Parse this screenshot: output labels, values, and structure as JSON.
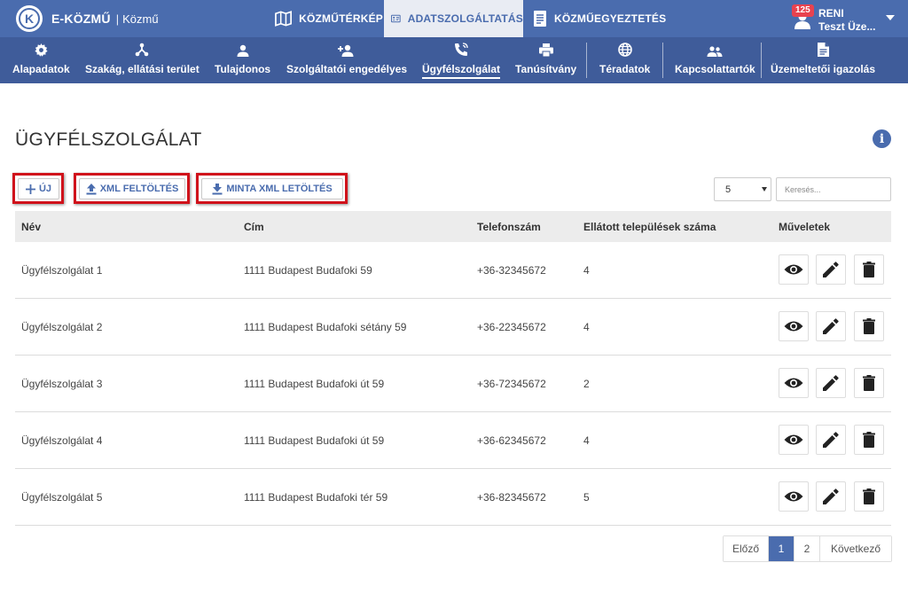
{
  "colors": {
    "primary": "#4a6cae",
    "subnav": "#3f5c9a",
    "highlight": "#d0121b",
    "badge": "#e8424f"
  },
  "brand": {
    "name": "E-KÖZMŰ",
    "separator": "|",
    "sub": "Közmű"
  },
  "top_tabs": [
    {
      "label": "KÖZMŰTÉRKÉP",
      "icon": "map-icon"
    },
    {
      "label": "ADATSZOLGÁLTATÁS",
      "icon": "id-card-icon",
      "active": true
    },
    {
      "label": "KÖZMŰEGYEZTETÉS",
      "icon": "document-icon"
    }
  ],
  "user": {
    "badge": "125",
    "name": "RENI",
    "org": "Teszt Üze..."
  },
  "subnav": [
    {
      "label": "Alapadatok",
      "icon": "gear-icon"
    },
    {
      "label": "Szakág, ellátási terület",
      "icon": "network-icon"
    },
    {
      "label": "Tulajdonos",
      "icon": "person-icon"
    },
    {
      "label": "Szolgáltatói engedélyes",
      "icon": "person-add-icon"
    },
    {
      "label": "Ügyfélszolgálat",
      "icon": "phone-icon",
      "active": true
    },
    {
      "label": "Tanúsítvány",
      "icon": "printer-icon"
    },
    {
      "label": "Téradatok",
      "icon": "globe-icon"
    },
    {
      "label": "Kapcsolattartók",
      "icon": "people-icon"
    },
    {
      "label": "Üzemeltetői igazolás",
      "icon": "file-icon"
    }
  ],
  "page": {
    "title": "ÜGYFÉLSZOLGÁLAT",
    "info": "i"
  },
  "toolbar": {
    "new_label": "ÚJ",
    "xml_upload_label": "XML FELTÖLTÉS",
    "sample_xml_label": "MINTA XML LETÖLTÉS",
    "page_size": "5",
    "search_placeholder": "Keresés..."
  },
  "table": {
    "headers": [
      "Név",
      "Cím",
      "Telefonszám",
      "Ellátott települések száma",
      "Műveletek"
    ],
    "rows": [
      [
        "Ügyfélszolgálat 1",
        "1111 Budapest Budafoki 59",
        "+36-32345672",
        "4"
      ],
      [
        "Ügyfélszolgálat 2",
        "1111 Budapest Budafoki sétány 59",
        "+36-22345672",
        "4"
      ],
      [
        "Ügyfélszolgálat 3",
        "1111 Budapest Budafoki út 59",
        "+36-72345672",
        "2"
      ],
      [
        "Ügyfélszolgálat 4",
        "1111 Budapest Budafoki út 59",
        "+36-62345672",
        "4"
      ],
      [
        "Ügyfélszolgálat 5",
        "1111 Budapest Budafoki tér 59",
        "+36-82345672",
        "5"
      ]
    ],
    "actions": [
      "eye-icon",
      "pencil-icon",
      "trash-icon"
    ]
  },
  "pagination": {
    "prev": "Előző",
    "pages": [
      "1",
      "2"
    ],
    "current": "1",
    "next": "Következő"
  }
}
